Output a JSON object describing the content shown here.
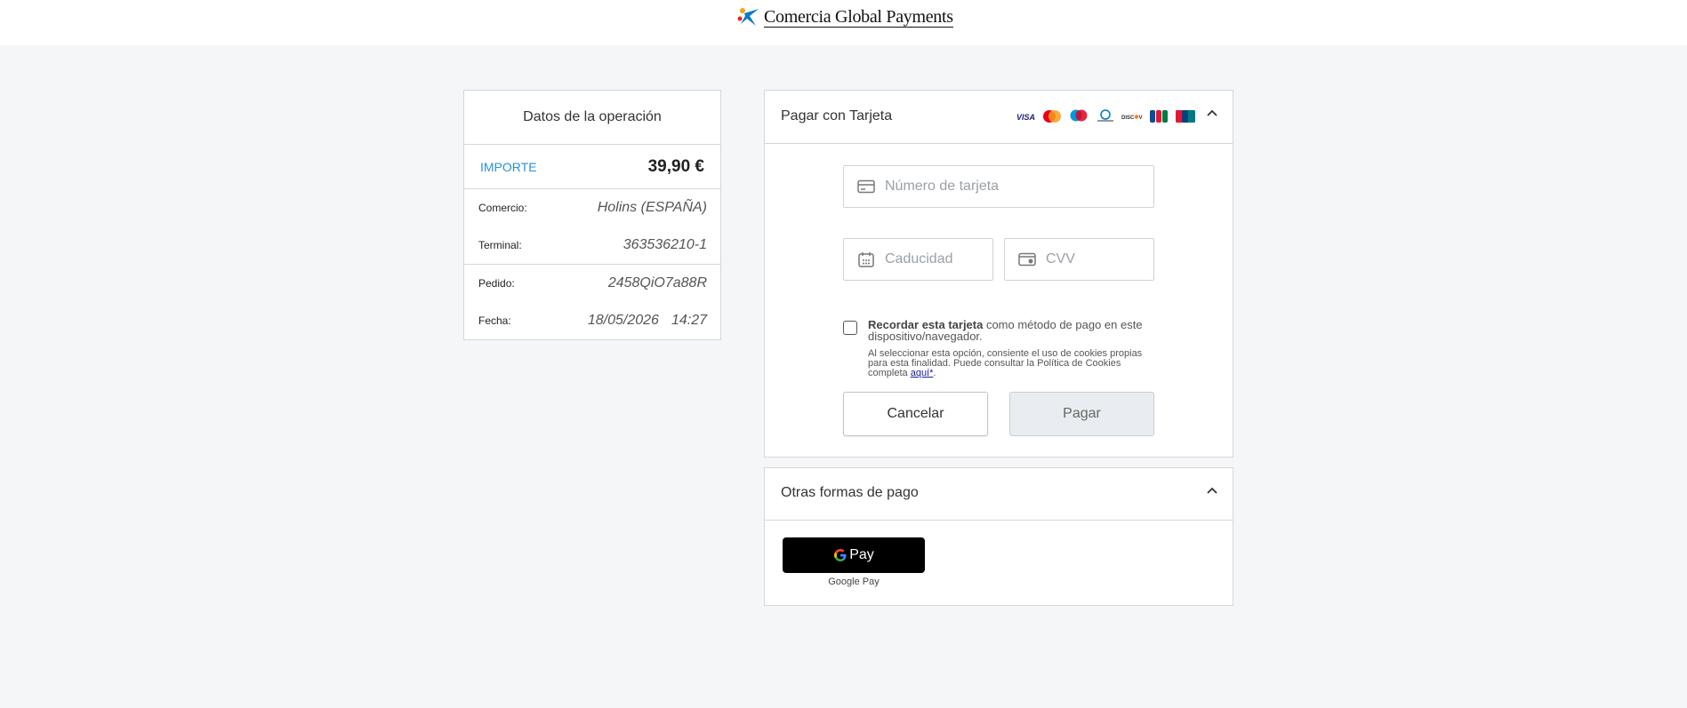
{
  "header": {
    "brand": "Comercia Global Payments"
  },
  "summary": {
    "title": "Datos de la operación",
    "amount_label": "IMPORTE",
    "amount_value": "39,90  €",
    "rows": [
      {
        "label": "Comercio:",
        "value": "Holins (ESPAÑA)"
      },
      {
        "label": "Terminal:",
        "value": "363536210-1"
      },
      {
        "label": "Pedido:",
        "value": "2458QiO7a88R"
      },
      {
        "label": "Fecha:",
        "date": "18/05/2026",
        "time": "14:27"
      }
    ]
  },
  "card": {
    "title": "Pagar con Tarjeta",
    "brands": [
      "visa",
      "mastercard",
      "maestro",
      "diners-club",
      "discover",
      "jcb",
      "unionpay"
    ],
    "card_number_placeholder": "Número de tarjeta",
    "expiry_placeholder": "Caducidad",
    "cvv_placeholder": "CVV",
    "remember_bold": "Recordar esta tarjeta",
    "remember_rest": " como método de pago en este dispositivo/navegador.",
    "consent_text": "Al seleccionar esta opción, consiente el uso de cookies propias para esta finalidad. Puede consultar la Política de Cookies completa ",
    "consent_link": "aquí*",
    "consent_end": ".",
    "cancel_label": "Cancelar",
    "pay_label": "Pagar"
  },
  "other": {
    "title": "Otras formas de pago",
    "gpay_label": "Pay",
    "gpay_caption": "Google Pay"
  }
}
